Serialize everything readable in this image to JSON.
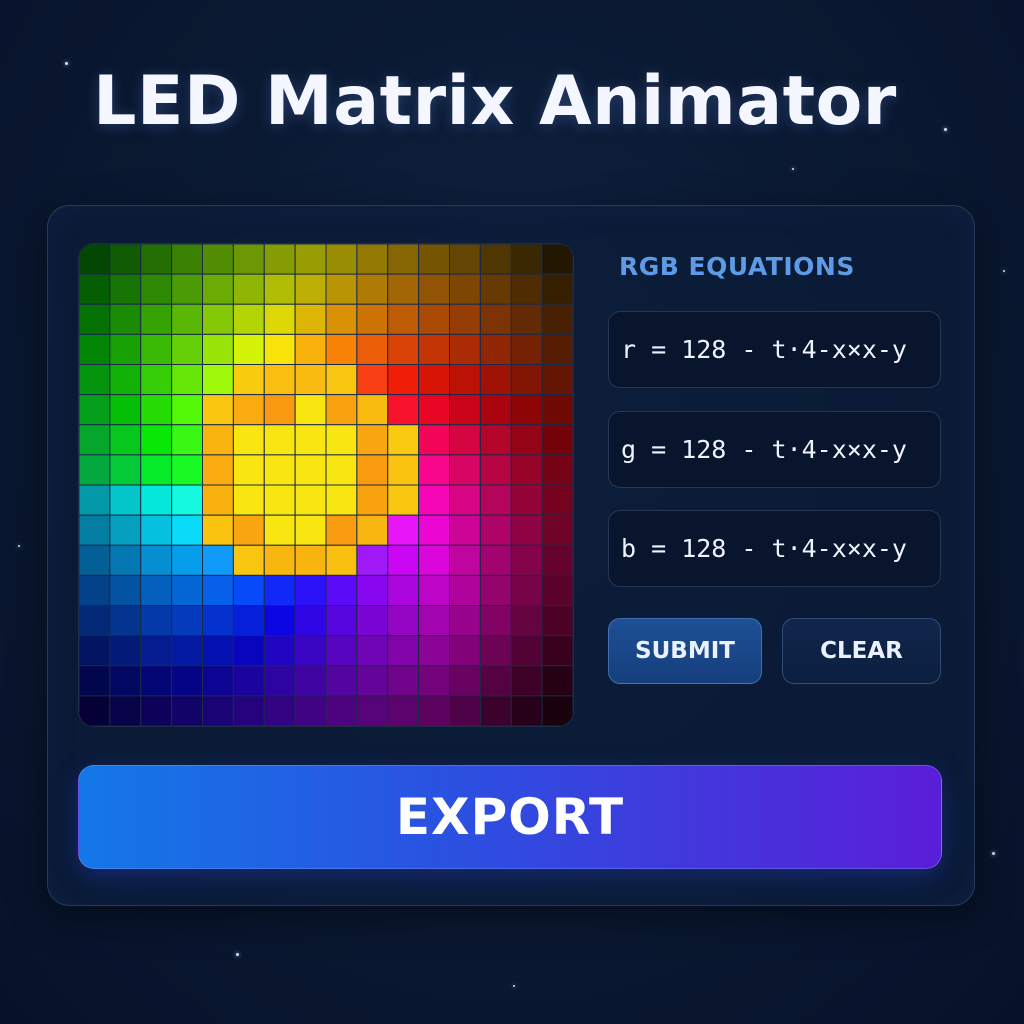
{
  "app": {
    "title": "LED Matrix Animator"
  },
  "equations": {
    "section_title": "RGB EQUATIONS",
    "r": "r = 128 - t·4-x×x-y",
    "g": "g = 128 - t·4-x×x-y",
    "b": "b = 128 - t·4-x×x-y"
  },
  "buttons": {
    "submit_label": "SUBMIT",
    "clear_label": "CLEAR",
    "export_label": "EXPORT"
  },
  "matrix": {
    "columns": 16,
    "rows": 16,
    "off_color": "#060c1c",
    "grid_color": "#1a2a48"
  },
  "colors": {
    "accent": "#5e9be6",
    "export_start": "#1477e8",
    "export_end": "#5a1ed8"
  }
}
